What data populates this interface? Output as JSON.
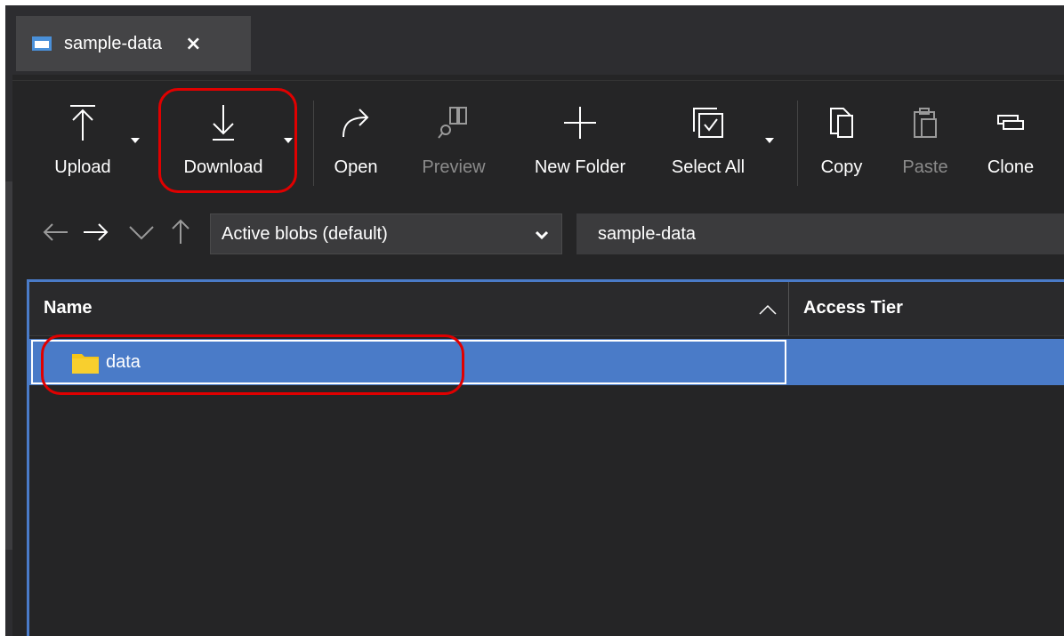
{
  "tab": {
    "title": "sample-data",
    "close_glyph": "×"
  },
  "toolbar": {
    "upload": "Upload",
    "download": "Download",
    "open": "Open",
    "preview": "Preview",
    "new_folder": "New Folder",
    "select_all": "Select All",
    "copy": "Copy",
    "paste": "Paste",
    "clone": "Clone"
  },
  "navigation": {
    "blob_filter": "Active blobs (default)",
    "path": "sample-data"
  },
  "table": {
    "columns": [
      "Name",
      "Access Tier"
    ],
    "rows": [
      {
        "name": "data",
        "access_tier": ""
      }
    ]
  },
  "colors": {
    "background": "#252526",
    "selection": "#4a7bc8",
    "annotation": "#e00000",
    "folder": "#f5c518"
  },
  "icons": {
    "upload": "upload-icon",
    "download": "download-icon",
    "open": "open-icon",
    "preview": "preview-icon",
    "new_folder": "plus-icon",
    "select_all": "select-all-icon",
    "copy": "copy-icon",
    "paste": "paste-icon",
    "clone": "clone-icon"
  }
}
